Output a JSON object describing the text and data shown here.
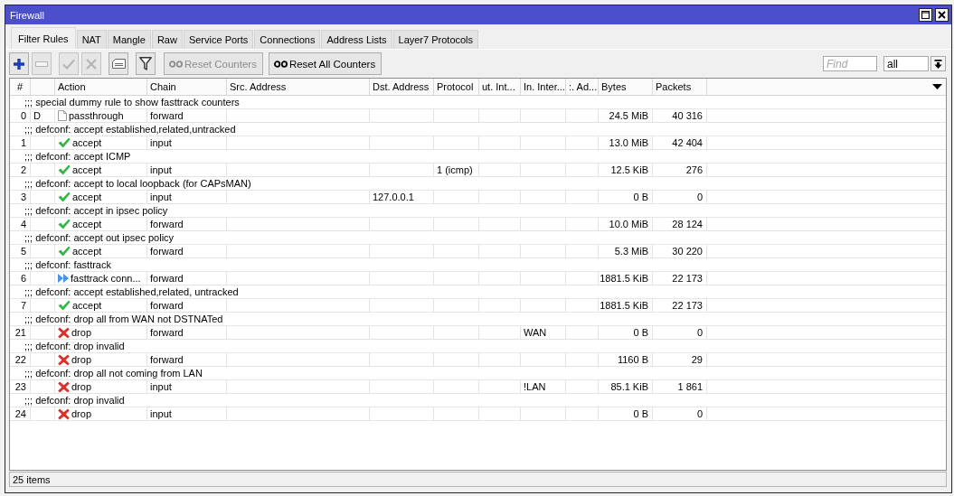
{
  "window": {
    "title": "Firewall"
  },
  "tabs": [
    {
      "label": "Filter Rules",
      "selected": true
    },
    {
      "label": "NAT",
      "selected": false
    },
    {
      "label": "Mangle",
      "selected": false
    },
    {
      "label": "Raw",
      "selected": false
    },
    {
      "label": "Service Ports",
      "selected": false
    },
    {
      "label": "Connections",
      "selected": false
    },
    {
      "label": "Address Lists",
      "selected": false
    },
    {
      "label": "Layer7 Protocols",
      "selected": false
    }
  ],
  "toolbar": {
    "icon_buttons": [
      {
        "kind": "add",
        "disabled": false
      },
      {
        "kind": "remove",
        "disabled": true
      },
      {
        "kind": "enable",
        "disabled": true
      },
      {
        "kind": "disable",
        "disabled": true
      },
      {
        "kind": "comment",
        "disabled": false
      },
      {
        "kind": "filter",
        "disabled": false
      }
    ],
    "text_buttons": [
      {
        "label": "Reset Counters",
        "disabled": true
      },
      {
        "label": "Reset All Counters",
        "disabled": false
      }
    ],
    "find": {
      "placeholder": "Find"
    },
    "scope": {
      "value": "all"
    }
  },
  "table": {
    "columns": [
      "#",
      "Action",
      "Chain",
      "Src. Address",
      "Dst. Address",
      "Protocol",
      "ut. Int...",
      "In. Inter...",
      ":. Ad...",
      "Bytes",
      "Packets"
    ],
    "rules": [
      {
        "comment": ";;; special dummy rule to show fasttrack counters",
        "number": "0",
        "flag": "D",
        "action": {
          "kind": "passthrough",
          "label": "passthrough"
        },
        "chain": "forward",
        "bytes": "24.5 MiB",
        "packets": "40 316"
      },
      {
        "comment": ";;; defconf: accept established,related,untracked",
        "number": "1",
        "action": {
          "kind": "accept",
          "label": "accept"
        },
        "chain": "input",
        "bytes": "13.0 MiB",
        "packets": "42 404"
      },
      {
        "comment": ";;; defconf: accept ICMP",
        "number": "2",
        "action": {
          "kind": "accept",
          "label": "accept"
        },
        "chain": "input",
        "protocol": "1 (icmp)",
        "bytes": "12.5 KiB",
        "packets": "276"
      },
      {
        "comment": ";;; defconf: accept to local loopback (for CAPsMAN)",
        "number": "3",
        "action": {
          "kind": "accept",
          "label": "accept"
        },
        "chain": "input",
        "dst_address": "127.0.0.1",
        "bytes": "0 B",
        "packets": "0"
      },
      {
        "comment": ";;; defconf: accept in ipsec policy",
        "number": "4",
        "action": {
          "kind": "accept",
          "label": "accept"
        },
        "chain": "forward",
        "bytes": "10.0 MiB",
        "packets": "28 124"
      },
      {
        "comment": ";;; defconf: accept out ipsec policy",
        "number": "5",
        "action": {
          "kind": "accept",
          "label": "accept"
        },
        "chain": "forward",
        "bytes": "5.3 MiB",
        "packets": "30 220"
      },
      {
        "comment": ";;; defconf: fasttrack",
        "number": "6",
        "action": {
          "kind": "fasttrack",
          "label": "fasttrack conn..."
        },
        "chain": "forward",
        "bytes": "1881.5 KiB",
        "packets": "22 173"
      },
      {
        "comment": ";;; defconf: accept established,related, untracked",
        "number": "7",
        "action": {
          "kind": "accept",
          "label": "accept"
        },
        "chain": "forward",
        "bytes": "1881.5 KiB",
        "packets": "22 173"
      },
      {
        "comment": ";;; defconf: drop all from WAN not DSTNATed",
        "number": "21",
        "action": {
          "kind": "drop",
          "label": "drop"
        },
        "chain": "forward",
        "in_interface": "WAN",
        "bytes": "0 B",
        "packets": "0"
      },
      {
        "comment": ";;; defconf: drop invalid",
        "number": "22",
        "action": {
          "kind": "drop",
          "label": "drop"
        },
        "chain": "forward",
        "bytes": "1160 B",
        "packets": "29"
      },
      {
        "comment": ";;; defconf: drop all not coming from LAN",
        "number": "23",
        "action": {
          "kind": "drop",
          "label": "drop"
        },
        "chain": "input",
        "in_interface": "!LAN",
        "bytes": "85.1 KiB",
        "packets": "1 861"
      },
      {
        "comment": ";;; defconf: drop invalid",
        "number": "24",
        "action": {
          "kind": "drop",
          "label": "drop"
        },
        "chain": "input",
        "bytes": "0 B",
        "packets": "0"
      }
    ]
  },
  "status_bar": {
    "text": "25 items"
  }
}
